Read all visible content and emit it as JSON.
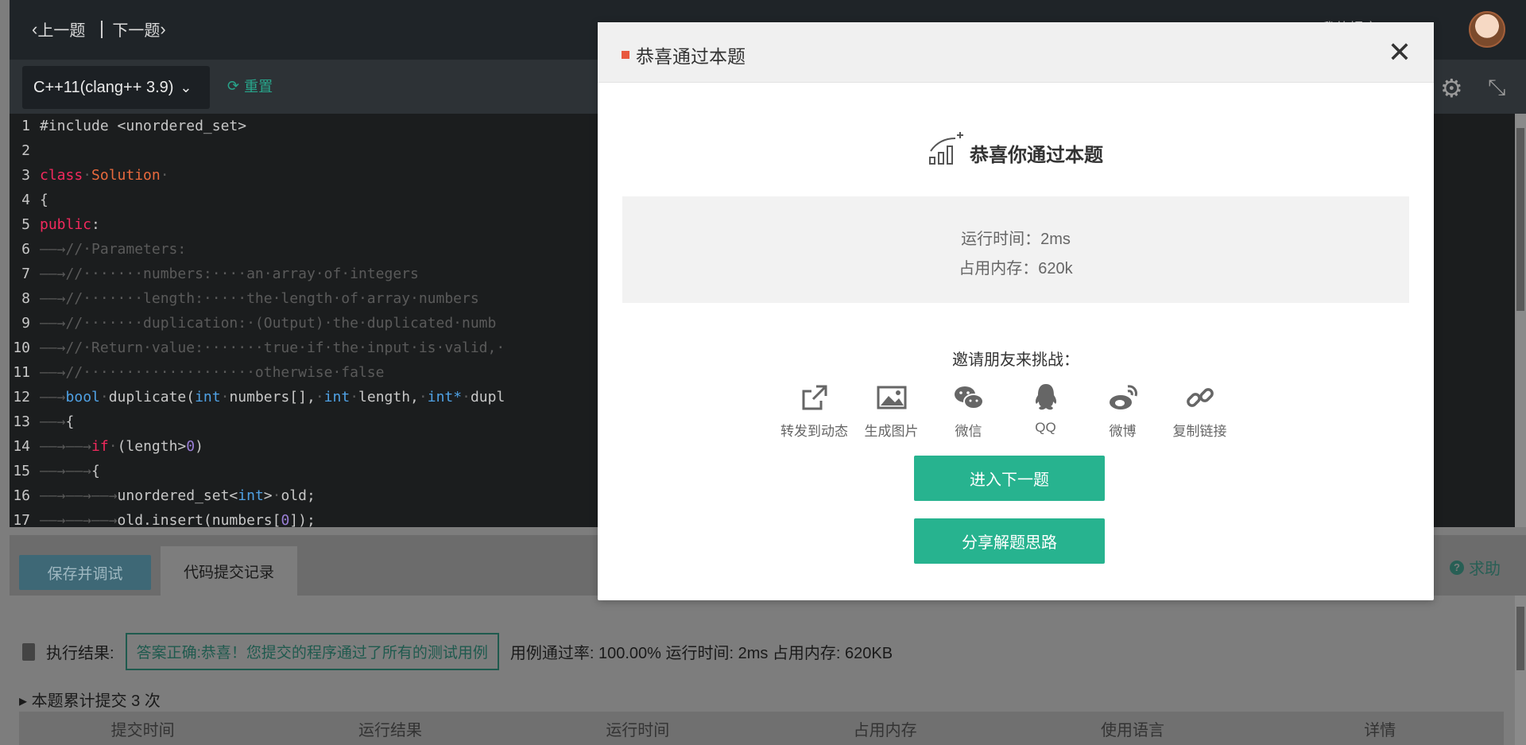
{
  "nav": {
    "prev": "上一题",
    "next": "下一题",
    "my_submissions": "我的提交"
  },
  "toolbar": {
    "language": "C++11(clang++ 3.9)",
    "reset": "重置"
  },
  "code": [
    {
      "n": "1"
    },
    {
      "n": "2"
    },
    {
      "n": "3"
    },
    {
      "n": "4"
    },
    {
      "n": "5"
    },
    {
      "n": "6"
    },
    {
      "n": "7"
    },
    {
      "n": "8"
    },
    {
      "n": "9"
    },
    {
      "n": "10"
    },
    {
      "n": "11"
    },
    {
      "n": "12"
    },
    {
      "n": "13"
    },
    {
      "n": "14"
    },
    {
      "n": "15"
    },
    {
      "n": "16"
    },
    {
      "n": "17"
    }
  ],
  "bottom": {
    "debug_button": "保存并调试",
    "tab_record": "代码提交记录",
    "help": "求助",
    "result_label": "执行结果:",
    "result_tag": "答案正确:恭喜！您提交的程序通过了所有的测试用例",
    "result_stats": "用例通过率: 100.00%   运行时间: 2ms   占用内存: 620KB",
    "submit_count": "本题累计提交 3 次",
    "table_headers": [
      "提交时间",
      "运行结果",
      "运行时间",
      "占用内存",
      "使用语言",
      "详情"
    ]
  },
  "modal": {
    "title": "恭喜通过本题",
    "hero": "恭喜你通过本题",
    "runtime": "运行时间：2ms",
    "memory": "占用内存：620k",
    "invite": "邀请朋友来挑战：",
    "share": [
      {
        "label": "转发到动态",
        "icon": "share-out-icon"
      },
      {
        "label": "生成图片",
        "icon": "image-icon"
      },
      {
        "label": "微信",
        "icon": "wechat-icon"
      },
      {
        "label": "QQ",
        "icon": "qq-icon"
      },
      {
        "label": "微博",
        "icon": "weibo-icon"
      },
      {
        "label": "复制链接",
        "icon": "link-icon"
      }
    ],
    "next_button": "进入下一题",
    "share_button": "分享解题思路"
  },
  "colors": {
    "accent": "#27b38f",
    "marker": "#e8593f"
  }
}
